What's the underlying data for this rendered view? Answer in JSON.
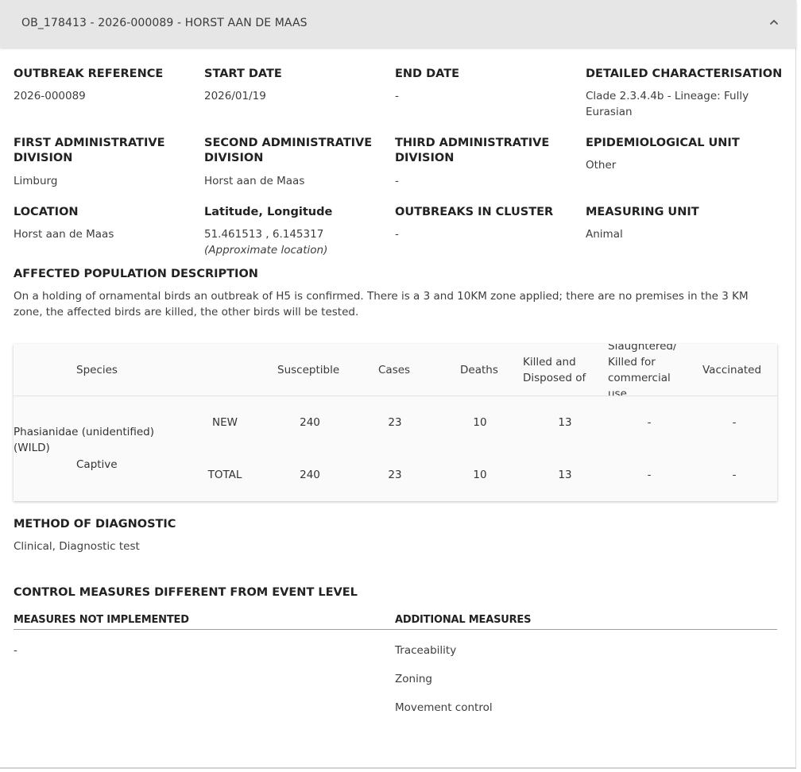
{
  "panel": {
    "title": "OB_178413 - 2026-000089 - HORST AAN DE MAAS"
  },
  "details": {
    "outbreak_reference": {
      "label": "OUTBREAK REFERENCE",
      "value": "2026-000089"
    },
    "start_date": {
      "label": "START DATE",
      "value": "2026/01/19"
    },
    "end_date": {
      "label": "END DATE",
      "value": "-"
    },
    "detailed_characterisation": {
      "label": "DETAILED CHARACTERISATION",
      "value": "Clade 2.3.4.4b - Lineage: Fully Eurasian"
    },
    "first_admin_division": {
      "label": "FIRST ADMINISTRATIVE DIVISION",
      "value": "Limburg"
    },
    "second_admin_division": {
      "label": "SECOND ADMINISTRATIVE DIVISION",
      "value": "Horst aan de Maas"
    },
    "third_admin_division": {
      "label": "THIRD ADMINISTRATIVE DIVISION",
      "value": "-"
    },
    "epidemiological_unit": {
      "label": "EPIDEMIOLOGICAL UNIT",
      "value": "Other"
    },
    "location": {
      "label": "LOCATION",
      "value": "Horst aan de Maas"
    },
    "lat_long": {
      "label": "Latitude, Longitude",
      "value": "51.461513 , 6.145317",
      "note": "(Approximate location)"
    },
    "outbreaks_in_cluster": {
      "label": "OUTBREAKS IN CLUSTER",
      "value": "-"
    },
    "measuring_unit": {
      "label": "MEASURING UNIT",
      "value": "Animal"
    },
    "affected_population": {
      "label": "AFFECTED POPULATION DESCRIPTION",
      "value": "On a holding of ornamental birds an outbreak of H5 is confirmed. There is a 3 and 10KM zone applied; there are no premises in the 3 KM zone, the affected birds are killed, the other birds will be tested."
    }
  },
  "table": {
    "headers": {
      "species": "Species",
      "susceptible": "Susceptible",
      "cases": "Cases",
      "deaths": "Deaths",
      "killed_disposed": "Killed and Disposed of",
      "slaughtered": "Slaughtered/ Killed for commercial use",
      "vaccinated": "Vaccinated"
    },
    "species_name": "Phasianidae (unidentified) (WILD)",
    "species_status": "Captive",
    "rows": [
      {
        "type": "NEW",
        "susceptible": "240",
        "cases": "23",
        "deaths": "10",
        "killed_disposed": "13",
        "slaughtered": "-",
        "vaccinated": "-"
      },
      {
        "type": "TOTAL",
        "susceptible": "240",
        "cases": "23",
        "deaths": "10",
        "killed_disposed": "13",
        "slaughtered": "-",
        "vaccinated": "-"
      }
    ]
  },
  "diagnostic": {
    "label": "METHOD OF DIAGNOSTIC",
    "value": "Clinical, Diagnostic test"
  },
  "control_measures": {
    "title": "CONTROL MEASURES DIFFERENT FROM EVENT LEVEL",
    "not_implemented_label": "MEASURES NOT IMPLEMENTED",
    "not_implemented": [
      "-"
    ],
    "additional_label": "ADDITIONAL MEASURES",
    "additional": [
      "Traceability",
      "Zoning",
      "Movement control"
    ]
  }
}
